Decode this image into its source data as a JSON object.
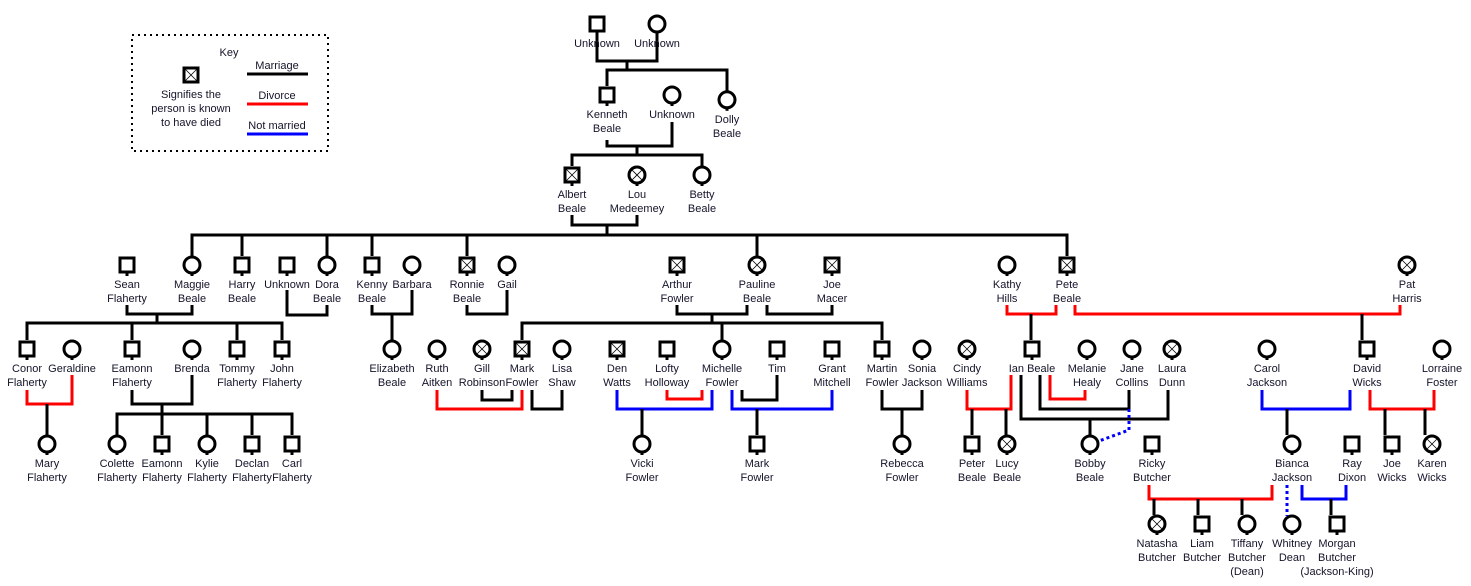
{
  "key": {
    "title": "Key",
    "deceased_lines": [
      "Signifies the",
      "person is known",
      "to have died"
    ],
    "marriage_label": "Marriage",
    "divorce_label": "Divorce",
    "not_married_label": "Not married",
    "colors": {
      "marriage": "#000000",
      "divorce": "#ff0000",
      "not_married": "#0000ff"
    }
  },
  "people": [
    {
      "lines": [
        "Unknown"
      ],
      "sex": "m",
      "deceased": false
    },
    {
      "lines": [
        "Unknown"
      ],
      "sex": "f",
      "deceased": false
    },
    {
      "lines": [
        "Kenneth",
        "Beale"
      ],
      "sex": "m",
      "deceased": false
    },
    {
      "lines": [
        "Unknown"
      ],
      "sex": "f",
      "deceased": false
    },
    {
      "lines": [
        "Dolly",
        "Beale"
      ],
      "sex": "f",
      "deceased": false
    },
    {
      "lines": [
        "Albert",
        "Beale"
      ],
      "sex": "m",
      "deceased": true
    },
    {
      "lines": [
        "Lou",
        "Medeemey"
      ],
      "sex": "f",
      "deceased": true
    },
    {
      "lines": [
        "Betty",
        "Beale"
      ],
      "sex": "f",
      "deceased": false
    },
    {
      "lines": [
        "Sean",
        "Flaherty"
      ],
      "sex": "m",
      "deceased": false
    },
    {
      "lines": [
        "Maggie",
        "Beale"
      ],
      "sex": "f",
      "deceased": false
    },
    {
      "lines": [
        "Harry",
        "Beale"
      ],
      "sex": "m",
      "deceased": false
    },
    {
      "lines": [
        "Unknown"
      ],
      "sex": "m",
      "deceased": false
    },
    {
      "lines": [
        "Dora",
        "Beale"
      ],
      "sex": "f",
      "deceased": false
    },
    {
      "lines": [
        "Kenny",
        "Beale"
      ],
      "sex": "m",
      "deceased": false
    },
    {
      "lines": [
        "Barbara"
      ],
      "sex": "f",
      "deceased": false
    },
    {
      "lines": [
        "Ronnie",
        "Beale"
      ],
      "sex": "m",
      "deceased": true
    },
    {
      "lines": [
        "Gail"
      ],
      "sex": "f",
      "deceased": false
    },
    {
      "lines": [
        "Arthur",
        "Fowler"
      ],
      "sex": "m",
      "deceased": true
    },
    {
      "lines": [
        "Pauline",
        "Beale"
      ],
      "sex": "f",
      "deceased": true
    },
    {
      "lines": [
        "Joe",
        "Macer"
      ],
      "sex": "m",
      "deceased": true
    },
    {
      "lines": [
        "Kathy",
        "Hills"
      ],
      "sex": "f",
      "deceased": false
    },
    {
      "lines": [
        "Pete",
        "Beale"
      ],
      "sex": "m",
      "deceased": true
    },
    {
      "lines": [
        "Pat",
        "Harris"
      ],
      "sex": "f",
      "deceased": true
    },
    {
      "lines": [
        "Conor",
        "Flaherty"
      ],
      "sex": "m",
      "deceased": false
    },
    {
      "lines": [
        "Geraldine"
      ],
      "sex": "f",
      "deceased": false
    },
    {
      "lines": [
        "Eamonn",
        "Flaherty"
      ],
      "sex": "m",
      "deceased": false
    },
    {
      "lines": [
        "Brenda"
      ],
      "sex": "f",
      "deceased": false
    },
    {
      "lines": [
        "Tommy",
        "Flaherty"
      ],
      "sex": "m",
      "deceased": false
    },
    {
      "lines": [
        "John",
        "Flaherty"
      ],
      "sex": "m",
      "deceased": false
    },
    {
      "lines": [
        "Elizabeth",
        "Beale"
      ],
      "sex": "f",
      "deceased": false
    },
    {
      "lines": [
        "Ruth",
        "Aitken"
      ],
      "sex": "f",
      "deceased": false
    },
    {
      "lines": [
        "Gill",
        "Robinson"
      ],
      "sex": "f",
      "deceased": true
    },
    {
      "lines": [
        "Mark",
        "Fowler"
      ],
      "sex": "m",
      "deceased": true
    },
    {
      "lines": [
        "Lisa",
        "Shaw"
      ],
      "sex": "f",
      "deceased": false
    },
    {
      "lines": [
        "Den",
        "Watts"
      ],
      "sex": "m",
      "deceased": true
    },
    {
      "lines": [
        "Lofty",
        "Holloway"
      ],
      "sex": "m",
      "deceased": false
    },
    {
      "lines": [
        "Michelle",
        "Fowler"
      ],
      "sex": "f",
      "deceased": false
    },
    {
      "lines": [
        "Tim"
      ],
      "sex": "m",
      "deceased": false
    },
    {
      "lines": [
        "Grant",
        "Mitchell"
      ],
      "sex": "m",
      "deceased": false
    },
    {
      "lines": [
        "Martin",
        "Fowler"
      ],
      "sex": "m",
      "deceased": false
    },
    {
      "lines": [
        "Sonia",
        "Jackson"
      ],
      "sex": "f",
      "deceased": false
    },
    {
      "lines": [
        "Cindy",
        "Williams"
      ],
      "sex": "f",
      "deceased": true
    },
    {
      "lines": [
        "Ian Beale"
      ],
      "sex": "m",
      "deceased": false
    },
    {
      "lines": [
        "Melanie",
        "Healy"
      ],
      "sex": "f",
      "deceased": false
    },
    {
      "lines": [
        "Jane",
        "Collins"
      ],
      "sex": "f",
      "deceased": false
    },
    {
      "lines": [
        "Laura",
        "Dunn"
      ],
      "sex": "f",
      "deceased": true
    },
    {
      "lines": [
        "Carol",
        "Jackson"
      ],
      "sex": "f",
      "deceased": false
    },
    {
      "lines": [
        "David",
        "Wicks"
      ],
      "sex": "m",
      "deceased": false
    },
    {
      "lines": [
        "Lorraine",
        "Foster"
      ],
      "sex": "f",
      "deceased": false
    },
    {
      "lines": [
        "Mary",
        "Flaherty"
      ],
      "sex": "f",
      "deceased": false
    },
    {
      "lines": [
        "Colette",
        "Flaherty"
      ],
      "sex": "f",
      "deceased": false
    },
    {
      "lines": [
        "Eamonn",
        "Flaherty"
      ],
      "sex": "m",
      "deceased": false
    },
    {
      "lines": [
        "Kylie",
        "Flaherty"
      ],
      "sex": "f",
      "deceased": false
    },
    {
      "lines": [
        "Declan",
        "Flaherty"
      ],
      "sex": "m",
      "deceased": false
    },
    {
      "lines": [
        "Carl",
        "Flaherty"
      ],
      "sex": "m",
      "deceased": false
    },
    {
      "lines": [
        "Vicki",
        "Fowler"
      ],
      "sex": "f",
      "deceased": false
    },
    {
      "lines": [
        "Mark",
        "Fowler"
      ],
      "sex": "m",
      "deceased": false
    },
    {
      "lines": [
        "Rebecca",
        "Fowler"
      ],
      "sex": "f",
      "deceased": false
    },
    {
      "lines": [
        "Peter",
        "Beale"
      ],
      "sex": "m",
      "deceased": false
    },
    {
      "lines": [
        "Lucy",
        "Beale"
      ],
      "sex": "f",
      "deceased": true
    },
    {
      "lines": [
        "Bobby",
        "Beale"
      ],
      "sex": "f",
      "deceased": false
    },
    {
      "lines": [
        "Ricky",
        "Butcher"
      ],
      "sex": "m",
      "deceased": false
    },
    {
      "lines": [
        "Bianca",
        "Jackson"
      ],
      "sex": "f",
      "deceased": false
    },
    {
      "lines": [
        "Ray",
        "Dixon"
      ],
      "sex": "m",
      "deceased": false
    },
    {
      "lines": [
        "Joe",
        "Wicks"
      ],
      "sex": "m",
      "deceased": false
    },
    {
      "lines": [
        "Karen",
        "Wicks"
      ],
      "sex": "f",
      "deceased": true
    },
    {
      "lines": [
        "Natasha",
        "Butcher"
      ],
      "sex": "f",
      "deceased": true
    },
    {
      "lines": [
        "Liam",
        "Butcher"
      ],
      "sex": "m",
      "deceased": false
    },
    {
      "lines": [
        "Tiffany",
        "Butcher",
        "(Dean)"
      ],
      "sex": "f",
      "deceased": false
    },
    {
      "lines": [
        "Whitney",
        "Dean"
      ],
      "sex": "f",
      "deceased": false
    },
    {
      "lines": [
        "Morgan",
        "Butcher",
        "(Jackson-King)"
      ],
      "sex": "m",
      "deceased": false
    }
  ]
}
